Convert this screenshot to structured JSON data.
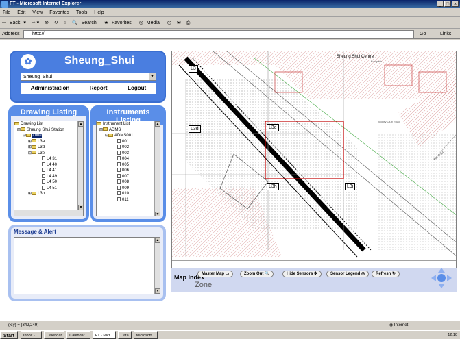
{
  "window": {
    "title": "FT - Microsoft Internet Explorer",
    "controls": [
      "_",
      "□",
      "×"
    ]
  },
  "menu": [
    "File",
    "Edit",
    "View",
    "Favorites",
    "Tools",
    "Help"
  ],
  "toolbar": {
    "back": "Back",
    "search": "Search",
    "favorites": "Favorites",
    "media": "Media"
  },
  "address": {
    "label": "Address",
    "value": "http://",
    "go": "Go",
    "links": "Links"
  },
  "header": {
    "site_title": "Sheung_Shui",
    "site_select": "Sheung_Shui",
    "nav": [
      "Administration",
      "Report",
      "Logout"
    ]
  },
  "drawing_listing": {
    "title": "Drawing Listing",
    "nodes": [
      "Drawing List",
      "Sheung Shui Station",
      "Zone",
      "L3a",
      "L3d",
      "L3e",
      "L4 31",
      "L4 40",
      "L4 41",
      "L4 49",
      "L4 50",
      "L4 51",
      "L3h"
    ]
  },
  "instruments_listing": {
    "title": "Instruments Listing",
    "nodes": [
      "Instrument List",
      "ADMS",
      "ADMS001",
      "001",
      "002",
      "003",
      "004",
      "005",
      "006",
      "007",
      "008",
      "009",
      "010",
      "011"
    ]
  },
  "message": {
    "title": "Message & Alert"
  },
  "map": {
    "title": "Sheung Shui Centre",
    "zones": [
      "L3",
      "L3d",
      "L3e",
      "L3h",
      "L3i"
    ],
    "labels": [
      "Footpath",
      "Jockey Club Road",
      "Fire Road"
    ]
  },
  "map_toolbar": {
    "buttons": [
      "Master Map",
      "Zoom Out",
      "Hide Sensors",
      "Sensor Legend",
      "Refresh"
    ],
    "index_label": "Map Index",
    "index_value": "Zone"
  },
  "status": {
    "coords": "(x,y) = (342,249)",
    "zone": "Internet"
  },
  "taskbar": {
    "start": "Start",
    "tasks": [
      "Inbox - ...",
      "Calendar",
      "Calendar...",
      "FT - Micr...",
      "Data",
      "Microsoft..."
    ],
    "clock": "12:10"
  },
  "colors": {
    "panel_blue": "#5a8ee8",
    "zone_highlight": "#c00000",
    "rail": "#000000"
  }
}
